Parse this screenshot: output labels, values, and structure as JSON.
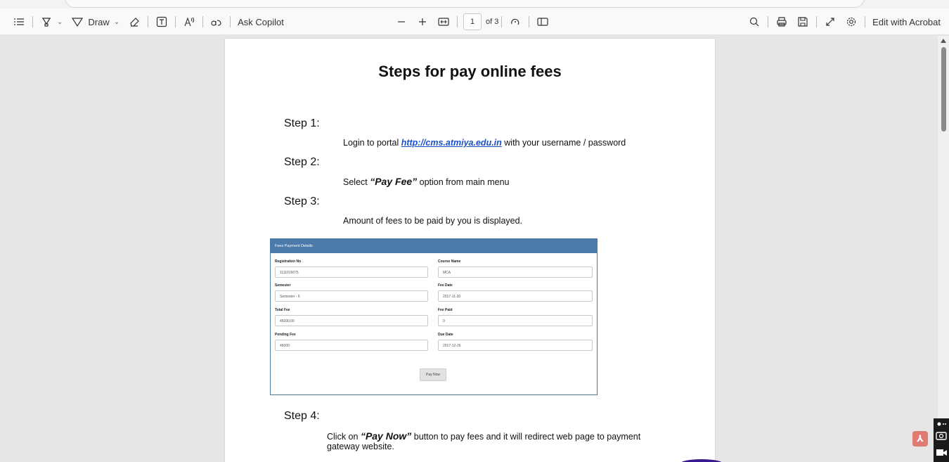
{
  "toolbar": {
    "draw_label": "Draw",
    "ask_copilot_label": "Ask Copilot",
    "page_number": "1",
    "page_count": "of 3",
    "edit_acrobat_label": "Edit with Acrobat"
  },
  "icons": [
    "contents-icon",
    "highlight-icon",
    "draw-icon",
    "erase-icon",
    "text-box-icon",
    "read-aloud-icon",
    "translate-icon",
    "zoom-out-icon",
    "zoom-in-icon",
    "fit-width-icon",
    "rotate-icon",
    "page-view-icon",
    "search-icon",
    "print-icon",
    "save-icon",
    "fullscreen-icon",
    "settings-icon"
  ],
  "document": {
    "title": "Steps for pay online fees",
    "steps": [
      {
        "label": "Step 1:"
      },
      {
        "label": "Step 2:"
      },
      {
        "label": "Step 3:"
      },
      {
        "label": "Step 4:"
      }
    ],
    "step1": {
      "prefix": "Login to portal ",
      "link": "http://cms.atmiya.edu.in",
      "suffix": " with your username / password"
    },
    "step2": {
      "prefix": "Select ",
      "emph": "“Pay Fee”",
      "suffix": " option from main menu"
    },
    "step3": {
      "text": "Amount of fees to be paid by you is displayed."
    },
    "step4": {
      "prefix": "Click on ",
      "emph": "“Pay Now”",
      "suffix": " button to pay fees and it will redirect web page to payment",
      "line2": "gateway website."
    },
    "form": {
      "header": "Fees Payment Details",
      "fields": [
        {
          "label": "Registration No",
          "value": "1111016075"
        },
        {
          "label": "Course Name",
          "value": "MCA"
        },
        {
          "label": "Semester",
          "value": "Semester - 6"
        },
        {
          "label": "Fee Date",
          "value": "2017-11-30"
        },
        {
          "label": "Total Fee",
          "value": "45000.00"
        },
        {
          "label": "Fee Paid",
          "value": "0"
        },
        {
          "label": "Pending Fee",
          "value": "45000"
        },
        {
          "label": "Due Date",
          "value": "2017-12-26"
        }
      ],
      "button": "Pay Now"
    }
  }
}
